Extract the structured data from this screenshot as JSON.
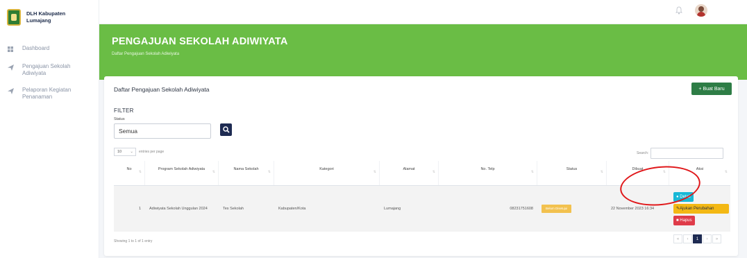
{
  "brand": {
    "name": "DLH Kabupaten Lumajang"
  },
  "sidebar": {
    "items": [
      {
        "label": "Dashboard",
        "icon": "dashboard-icon"
      },
      {
        "label": "Pengajuan Sekolah Adiwiyata",
        "icon": "send-icon"
      },
      {
        "label": "Pelaporan Kegiatan Penanaman",
        "icon": "send-icon"
      }
    ]
  },
  "header": {
    "title": "PENGAJUAN SEKOLAH ADIWIYATA",
    "subtitle": "Daftar Pengajuan Sekolah Adiwiyata"
  },
  "card": {
    "title": "Daftar Pengajuan Sekolah Adiwiyata",
    "new_button": "Buat Baru",
    "filter_heading": "FILTER",
    "status_label": "Status",
    "status_value": "Semua",
    "length_value": "10",
    "length_text": "entries per page",
    "search_label": "Search:"
  },
  "table": {
    "columns": [
      "No",
      "Program Sekolah Adiwiyata",
      "Nama Sekolah",
      "Kategori",
      "Alamat",
      "No. Telp",
      "Status",
      "Dibuat",
      "Aksi"
    ],
    "rows": [
      {
        "no": "1",
        "program": "Adiwiyata Sekolah Unggulan 2024",
        "nama": "Tes Sekolah",
        "kategori": "Kabupaten/Kota",
        "alamat": "Lumajang",
        "telp": "08231751608",
        "status": "Belum Disetujui",
        "dibuat": "22 November 2023 16:34"
      }
    ]
  },
  "actions": {
    "detail": "Detail",
    "edit": "Ajukan Perubahan",
    "delete": "Hapus"
  },
  "footer": {
    "showing": "Showing 1 to 1 of 1 entry",
    "pages": [
      "«",
      "‹",
      "1",
      "›",
      "»"
    ]
  },
  "colors": {
    "accent_green": "#6abd45",
    "primary_navy": "#1e2b52",
    "annotation_red": "#e0171a"
  }
}
